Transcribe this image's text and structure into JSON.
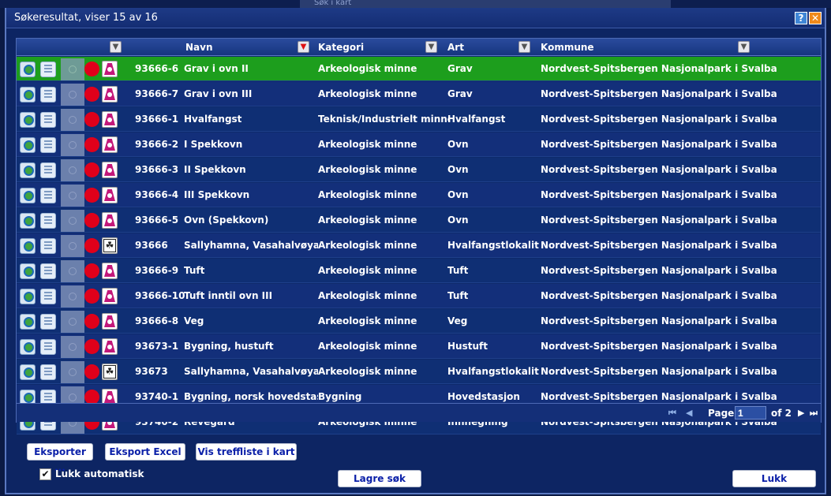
{
  "background_strip": "Søk i kart",
  "dialog": {
    "title": "Søkeresultat, viser 15 av 16",
    "help_label": "?",
    "close_label": "✕"
  },
  "columns": {
    "navn": "Navn",
    "kategori": "Kategori",
    "art": "Art",
    "kommune": "Kommune"
  },
  "rows": [
    {
      "id": "93666-6",
      "navn": "Grav i ovn II",
      "kategori": "Arkeologisk minne",
      "art": "Grav",
      "kommune": "Nordvest-Spitsbergen Nasjonalpark i Svalbard",
      "type": "site"
    },
    {
      "id": "93666-7",
      "navn": "Grav i ovn III",
      "kategori": "Arkeologisk minne",
      "art": "Grav",
      "kommune": "Nordvest-Spitsbergen Nasjonalpark i Svalbard",
      "type": "site"
    },
    {
      "id": "93666-1",
      "navn": "Hvalfangst",
      "kategori": "Teknisk/Industrielt minne",
      "art": "Hvalfangst",
      "kommune": "Nordvest-Spitsbergen Nasjonalpark i Svalbard",
      "type": "site"
    },
    {
      "id": "93666-2",
      "navn": "I Spekkovn",
      "kategori": "Arkeologisk minne",
      "art": "Ovn",
      "kommune": "Nordvest-Spitsbergen Nasjonalpark i Svalbard",
      "type": "site"
    },
    {
      "id": "93666-3",
      "navn": "II Spekkovn",
      "kategori": "Arkeologisk minne",
      "art": "Ovn",
      "kommune": "Nordvest-Spitsbergen Nasjonalpark i Svalbard",
      "type": "site"
    },
    {
      "id": "93666-4",
      "navn": "III Spekkovn",
      "kategori": "Arkeologisk minne",
      "art": "Ovn",
      "kommune": "Nordvest-Spitsbergen Nasjonalpark i Svalbard",
      "type": "site"
    },
    {
      "id": "93666-5",
      "navn": "Ovn (Spekkovn)",
      "kategori": "Arkeologisk minne",
      "art": "Ovn",
      "kommune": "Nordvest-Spitsbergen Nasjonalpark i Svalbard",
      "type": "site"
    },
    {
      "id": "93666",
      "navn": "Sallyhamna, Vasahalvøya",
      "kategori": "Arkeologisk minne",
      "art": "Hvalfangstlokalitet",
      "kommune": "Nordvest-Spitsbergen Nasjonalpark i Svalbard",
      "type": "locality"
    },
    {
      "id": "93666-9",
      "navn": "Tuft",
      "kategori": "Arkeologisk minne",
      "art": "Tuft",
      "kommune": "Nordvest-Spitsbergen Nasjonalpark i Svalbard",
      "type": "site"
    },
    {
      "id": "93666-10",
      "navn": "Tuft inntil ovn III",
      "kategori": "Arkeologisk minne",
      "art": "Tuft",
      "kommune": "Nordvest-Spitsbergen Nasjonalpark i Svalbard",
      "type": "site"
    },
    {
      "id": "93666-8",
      "navn": "Veg",
      "kategori": "Arkeologisk minne",
      "art": "Veg",
      "kommune": "Nordvest-Spitsbergen Nasjonalpark i Svalbard",
      "type": "site"
    },
    {
      "id": "93673-1",
      "navn": "Bygning, hustuft",
      "kategori": "Arkeologisk minne",
      "art": "Hustuft",
      "kommune": "Nordvest-Spitsbergen Nasjonalpark i Svalbard",
      "type": "site"
    },
    {
      "id": "93673",
      "navn": "Sallyhamna, Vasahalvøya",
      "kategori": "Arkeologisk minne",
      "art": "Hvalfangstlokalitet",
      "kommune": "Nordvest-Spitsbergen Nasjonalpark i Svalbard",
      "type": "locality"
    },
    {
      "id": "93740-1",
      "navn": "Bygning, norsk hovedstas...",
      "kategori": "Bygning",
      "art": "Hovedstasjon",
      "kommune": "Nordvest-Spitsbergen Nasjonalpark i Svalbard",
      "type": "site"
    },
    {
      "id": "93740-2",
      "navn": "Revegård",
      "kategori": "Arkeologisk minne",
      "art": "Innhegning",
      "kommune": "Nordvest-Spitsbergen Nasjonalpark i Svalbard",
      "type": "site"
    }
  ],
  "selected_row": 0,
  "pager": {
    "page_label": "Page",
    "page_value": "1",
    "of_label": "of 2",
    "first": "⏮",
    "prev": "◀",
    "next": "▶",
    "last": "⏭"
  },
  "buttons": {
    "eksporter": "Eksporter ...",
    "eksport_excel": "Eksport Excel",
    "vis_treffliste": "Vis treffliste i kart",
    "lagre_sok": "Lagre søk",
    "lukk": "Lukk"
  },
  "auto_close": {
    "label": "Lukk automatisk",
    "checked": true,
    "check_glyph": "✔"
  },
  "colors": {
    "selected_row": "#1d9e1d",
    "row_bg": "#0f2f74",
    "button_text": "#0a1fa8"
  }
}
